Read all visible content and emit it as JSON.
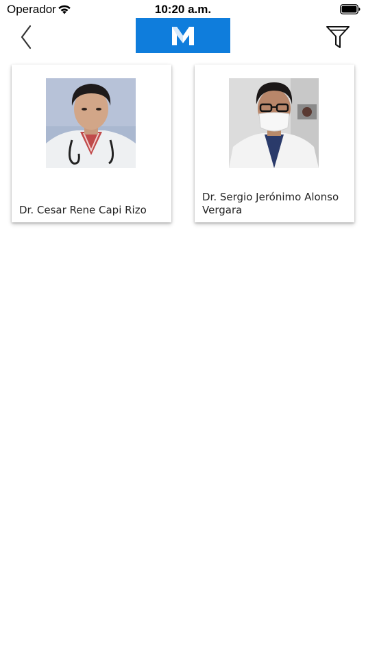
{
  "status_bar": {
    "carrier": "Operador",
    "time": "10:20 a.m."
  },
  "nav": {
    "back_icon": "chevron-left-icon",
    "logo_letter": "M",
    "logo_color": "#0f7ddc",
    "filter_icon": "funnel-icon"
  },
  "doctors": [
    {
      "name": "Dr. Cesar Rene Capi Rizo"
    },
    {
      "name": "Dr. Sergio Jerónimo Alonso Vergara"
    }
  ]
}
